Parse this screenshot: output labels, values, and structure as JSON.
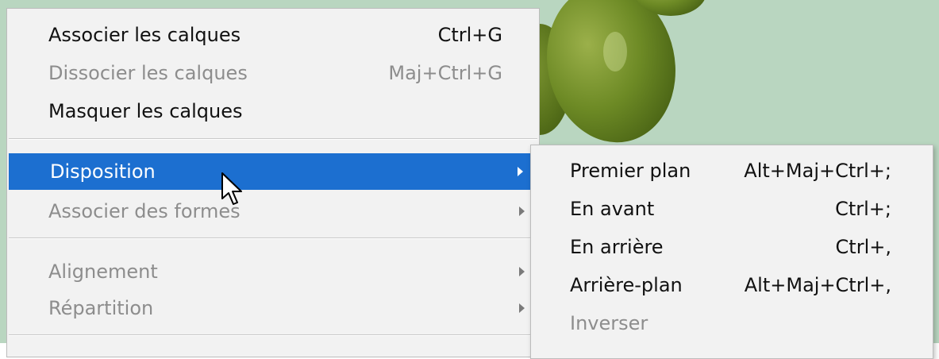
{
  "main_menu": {
    "items": [
      {
        "label": "Associer les calques",
        "shortcut": "Ctrl+G",
        "enabled": true
      },
      {
        "label": "Dissocier les calques",
        "shortcut": "Maj+Ctrl+G",
        "enabled": false
      },
      {
        "label": "Masquer les calques",
        "shortcut": "",
        "enabled": true
      },
      {
        "label": "Disposition",
        "shortcut": "",
        "enabled": true,
        "highlighted": true,
        "has_submenu": true
      },
      {
        "label": "Associer des formes",
        "shortcut": "",
        "enabled": false,
        "has_submenu": true
      },
      {
        "label": "Alignement",
        "shortcut": "",
        "enabled": false,
        "has_submenu": true
      },
      {
        "label": "Répartition",
        "shortcut": "",
        "enabled": false,
        "has_submenu": true
      }
    ]
  },
  "sub_menu": {
    "items": [
      {
        "label": "Premier plan",
        "shortcut": "Alt+Maj+Ctrl+;",
        "enabled": true
      },
      {
        "label": "En avant",
        "shortcut": "Ctrl+;",
        "enabled": true
      },
      {
        "label": "En arrière",
        "shortcut": "Ctrl+,",
        "enabled": true
      },
      {
        "label": "Arrière-plan",
        "shortcut": "Alt+Maj+Ctrl+,",
        "enabled": true
      },
      {
        "label": "Inverser",
        "shortcut": "",
        "enabled": false
      }
    ]
  },
  "colors": {
    "highlight": "#1c6fd0",
    "menu_bg": "#f2f2f2",
    "disabled_text": "#8d8d8d",
    "canvas_bg": "#b9d6c0"
  },
  "icons": {
    "submenu_arrow": "chevron-right-icon",
    "cursor": "mouse-pointer-icon"
  }
}
